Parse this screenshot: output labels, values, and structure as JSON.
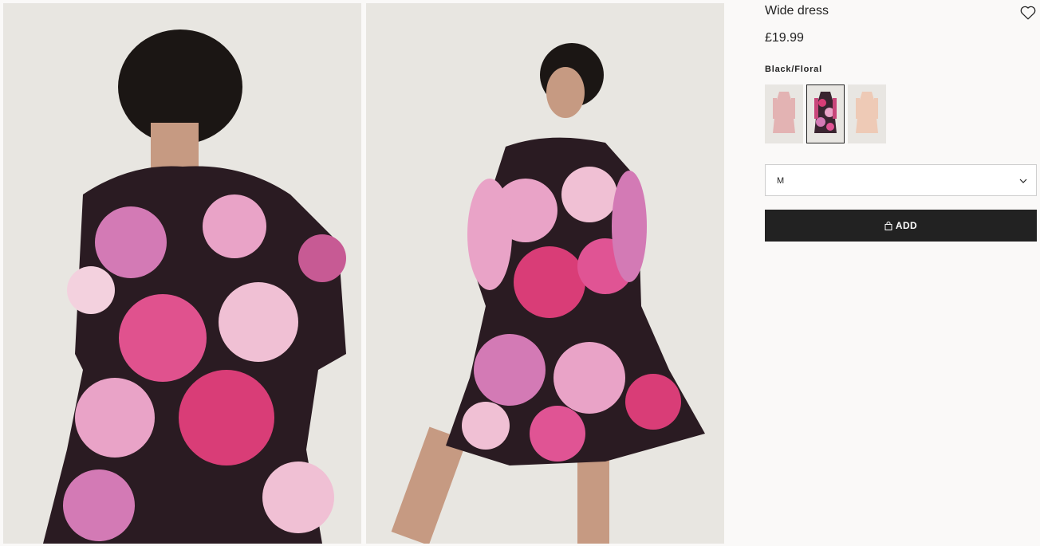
{
  "product": {
    "title": "Wide dress",
    "price": "£19.99",
    "colour_name": "Black/Floral"
  },
  "images": [
    {
      "name": "dress-back-view-image"
    },
    {
      "name": "dress-front-view-image"
    }
  ],
  "swatches": [
    {
      "name": "light-pink-floral",
      "selected": false,
      "color": "#e6b8b7"
    },
    {
      "name": "black-floral",
      "selected": true,
      "color": "#c8467a"
    },
    {
      "name": "beige",
      "selected": false,
      "color": "#ecc8b4"
    }
  ],
  "size_select": {
    "value": "M"
  },
  "add_button": {
    "label": "ADD"
  },
  "icons": {
    "favorite": "heart-icon",
    "dropdown": "chevron-down-icon",
    "bag": "shopping-bag-icon"
  },
  "colors": {
    "button_bg": "#222222",
    "page_bg": "#faf9f8"
  }
}
